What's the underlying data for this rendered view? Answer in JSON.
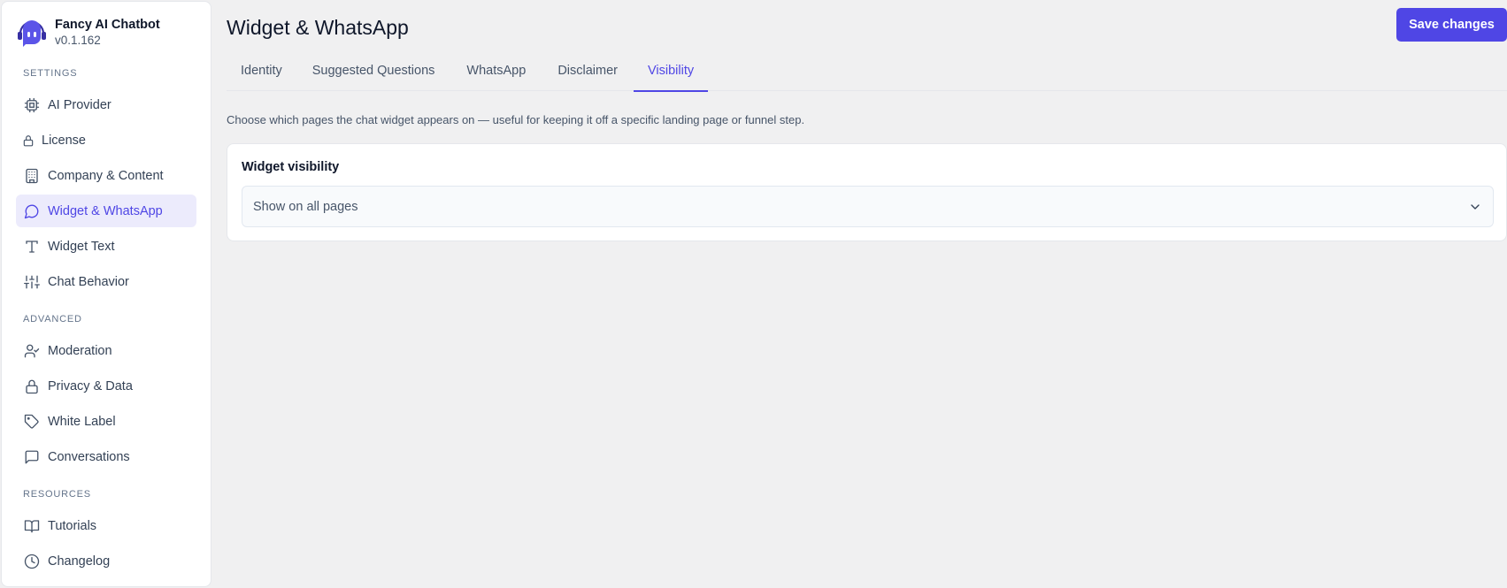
{
  "app": {
    "name": "Fancy AI Chatbot",
    "version": "v0.1.162",
    "accent_color": "#4f46e5"
  },
  "sidebar": {
    "sections": [
      {
        "label": "SETTINGS",
        "items": [
          {
            "label": "AI Provider",
            "icon": "cpu-icon",
            "active": false
          },
          {
            "label": "License",
            "icon": "lock-icon",
            "active": false
          },
          {
            "label": "Company & Content",
            "icon": "building-icon",
            "active": false
          },
          {
            "label": "Widget & WhatsApp",
            "icon": "message-circle-icon",
            "active": true
          },
          {
            "label": "Widget Text",
            "icon": "type-icon",
            "active": false
          },
          {
            "label": "Chat Behavior",
            "icon": "sliders-icon",
            "active": false
          }
        ]
      },
      {
        "label": "ADVANCED",
        "items": [
          {
            "label": "Moderation",
            "icon": "user-check-icon",
            "active": false
          },
          {
            "label": "Privacy & Data",
            "icon": "lock-icon",
            "active": false
          },
          {
            "label": "White Label",
            "icon": "tag-icon",
            "active": false
          },
          {
            "label": "Conversations",
            "icon": "message-square-icon",
            "active": false
          }
        ]
      },
      {
        "label": "RESOURCES",
        "items": [
          {
            "label": "Tutorials",
            "icon": "book-open-icon",
            "active": false
          },
          {
            "label": "Changelog",
            "icon": "clock-icon",
            "active": false
          }
        ]
      }
    ]
  },
  "header": {
    "title": "Widget & WhatsApp",
    "save_label": "Save changes"
  },
  "tabs": [
    {
      "label": "Identity",
      "active": false
    },
    {
      "label": "Suggested Questions",
      "active": false
    },
    {
      "label": "WhatsApp",
      "active": false
    },
    {
      "label": "Disclaimer",
      "active": false
    },
    {
      "label": "Visibility",
      "active": true
    }
  ],
  "content": {
    "description": "Choose which pages the chat widget appears on — useful for keeping it off a specific landing page or funnel step.",
    "card_title": "Widget visibility",
    "select_value": "Show on all pages"
  }
}
